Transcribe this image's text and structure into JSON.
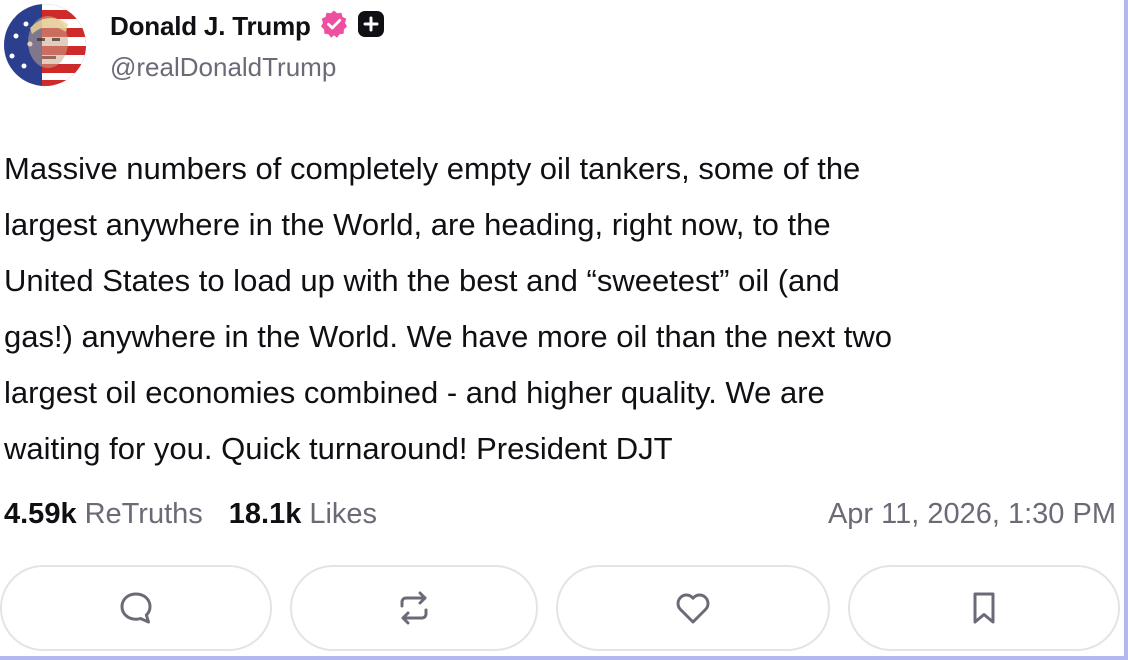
{
  "author": {
    "display_name": "Donald J. Trump",
    "handle": "@realDonaldTrump",
    "verified_badge_icon": "verified-badge-icon",
    "plus_badge_icon": "plus-badge-icon",
    "badge_color": "#ee4fa0"
  },
  "post": {
    "lines": [
      "Massive numbers of completely empty oil tankers, some of the",
      "largest anywhere in the World, are heading, right now, to the",
      "United States to load up with the best and “sweetest” oil (and",
      "gas!) anywhere in the World. We have more oil than the next two",
      "largest oil economies combined - and higher quality. We are",
      "waiting for you. Quick turnaround! President DJT"
    ]
  },
  "stats": {
    "retruths_count": "4.59k",
    "retruths_label": "ReTruths",
    "likes_count": "18.1k",
    "likes_label": "Likes",
    "timestamp": "Apr 11, 2026, 1:30 PM"
  },
  "actions": [
    {
      "name": "reply",
      "icon": "comment-icon"
    },
    {
      "name": "retruth",
      "icon": "repost-icon"
    },
    {
      "name": "like",
      "icon": "heart-icon"
    },
    {
      "name": "bookmark",
      "icon": "bookmark-icon"
    }
  ],
  "colors": {
    "text_primary": "#0f0f14",
    "text_secondary": "#6b6b78",
    "icon": "#6b6b78",
    "frame_border": "#b4b8f0"
  }
}
